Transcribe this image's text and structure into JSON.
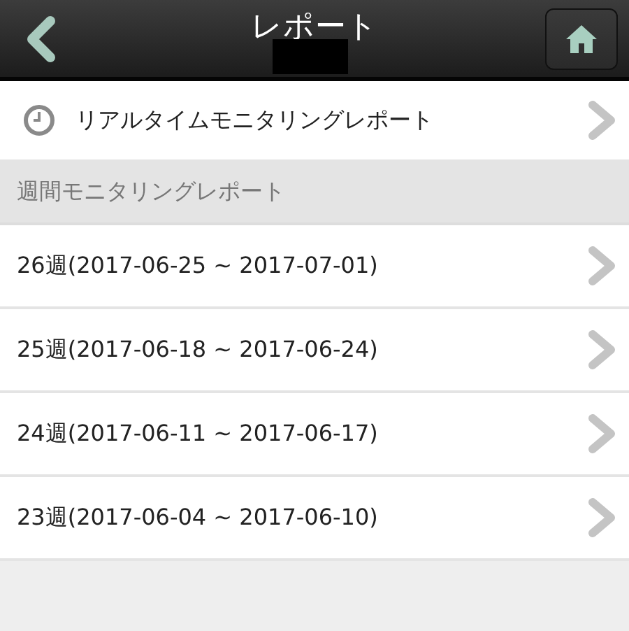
{
  "header": {
    "title": "レポート"
  },
  "realtime": {
    "label": "リアルタイムモニタリングレポート"
  },
  "section": {
    "title": "週間モニタリングレポート"
  },
  "weeks": [
    {
      "label": "26週(2017-06-25 ~ 2017-07-01)"
    },
    {
      "label": "25週(2017-06-18 ~ 2017-06-24)"
    },
    {
      "label": "24週(2017-06-11 ~ 2017-06-17)"
    },
    {
      "label": "23週(2017-06-04 ~ 2017-06-10)"
    }
  ]
}
